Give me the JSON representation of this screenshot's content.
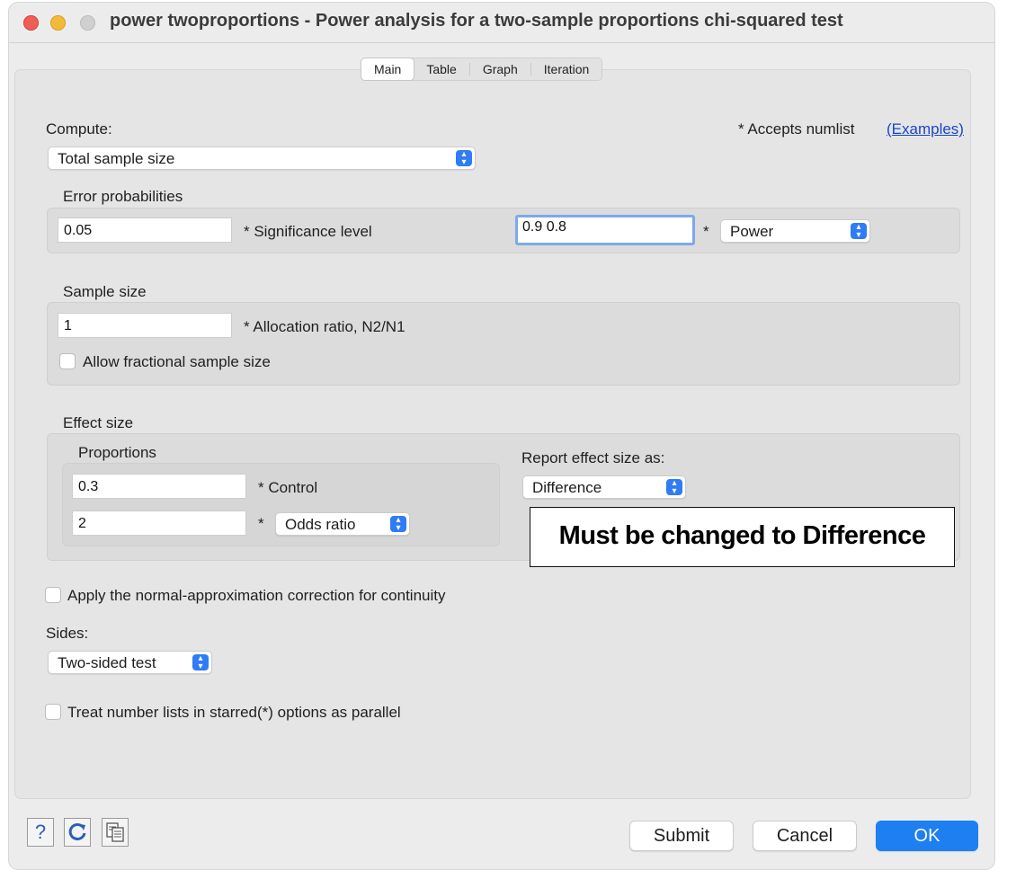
{
  "window": {
    "title": "power twoproportions - Power analysis for a two-sample proportions chi-squared test"
  },
  "tabs": [
    "Main",
    "Table",
    "Graph",
    "Iteration"
  ],
  "compute": {
    "label": "Compute:",
    "value": "Total sample size",
    "accepts_note": "* Accepts numlist",
    "examples_link": "(Examples)"
  },
  "error_probabilities": {
    "heading": "Error probabilities",
    "significance_value": "0.05",
    "significance_label": "* Significance level",
    "power_value": "0.9 0.8",
    "power_star": "*",
    "power_select": "Power"
  },
  "sample_size": {
    "heading": "Sample size",
    "allocation_value": "1",
    "allocation_label": "* Allocation ratio, N2/N1",
    "fractional_label": "Allow fractional sample size",
    "fractional_checked": false
  },
  "effect_size": {
    "heading": "Effect size",
    "proportions_heading": "Proportions",
    "control_value": "0.3",
    "control_label": "* Control",
    "experimental_value": "2",
    "experimental_star": "*",
    "experimental_select": "Odds ratio",
    "report_label": "Report effect size as:",
    "report_select": "Difference"
  },
  "annotation": {
    "text": "Must be changed to Difference"
  },
  "continuity": {
    "label": "Apply the normal-approximation correction for continuity",
    "checked": false
  },
  "sides": {
    "label": "Sides:",
    "value": "Two-sided test"
  },
  "parallel": {
    "label": "Treat number lists in starred(*) options as parallel",
    "checked": false
  },
  "footer": {
    "help_icon_text": "?",
    "submit": "Submit",
    "cancel": "Cancel",
    "ok": "OK"
  },
  "colors": {
    "accent": "#1d7ff0",
    "link": "#1a45c9",
    "close": "#ee5e55",
    "minimize": "#f4b93a"
  }
}
